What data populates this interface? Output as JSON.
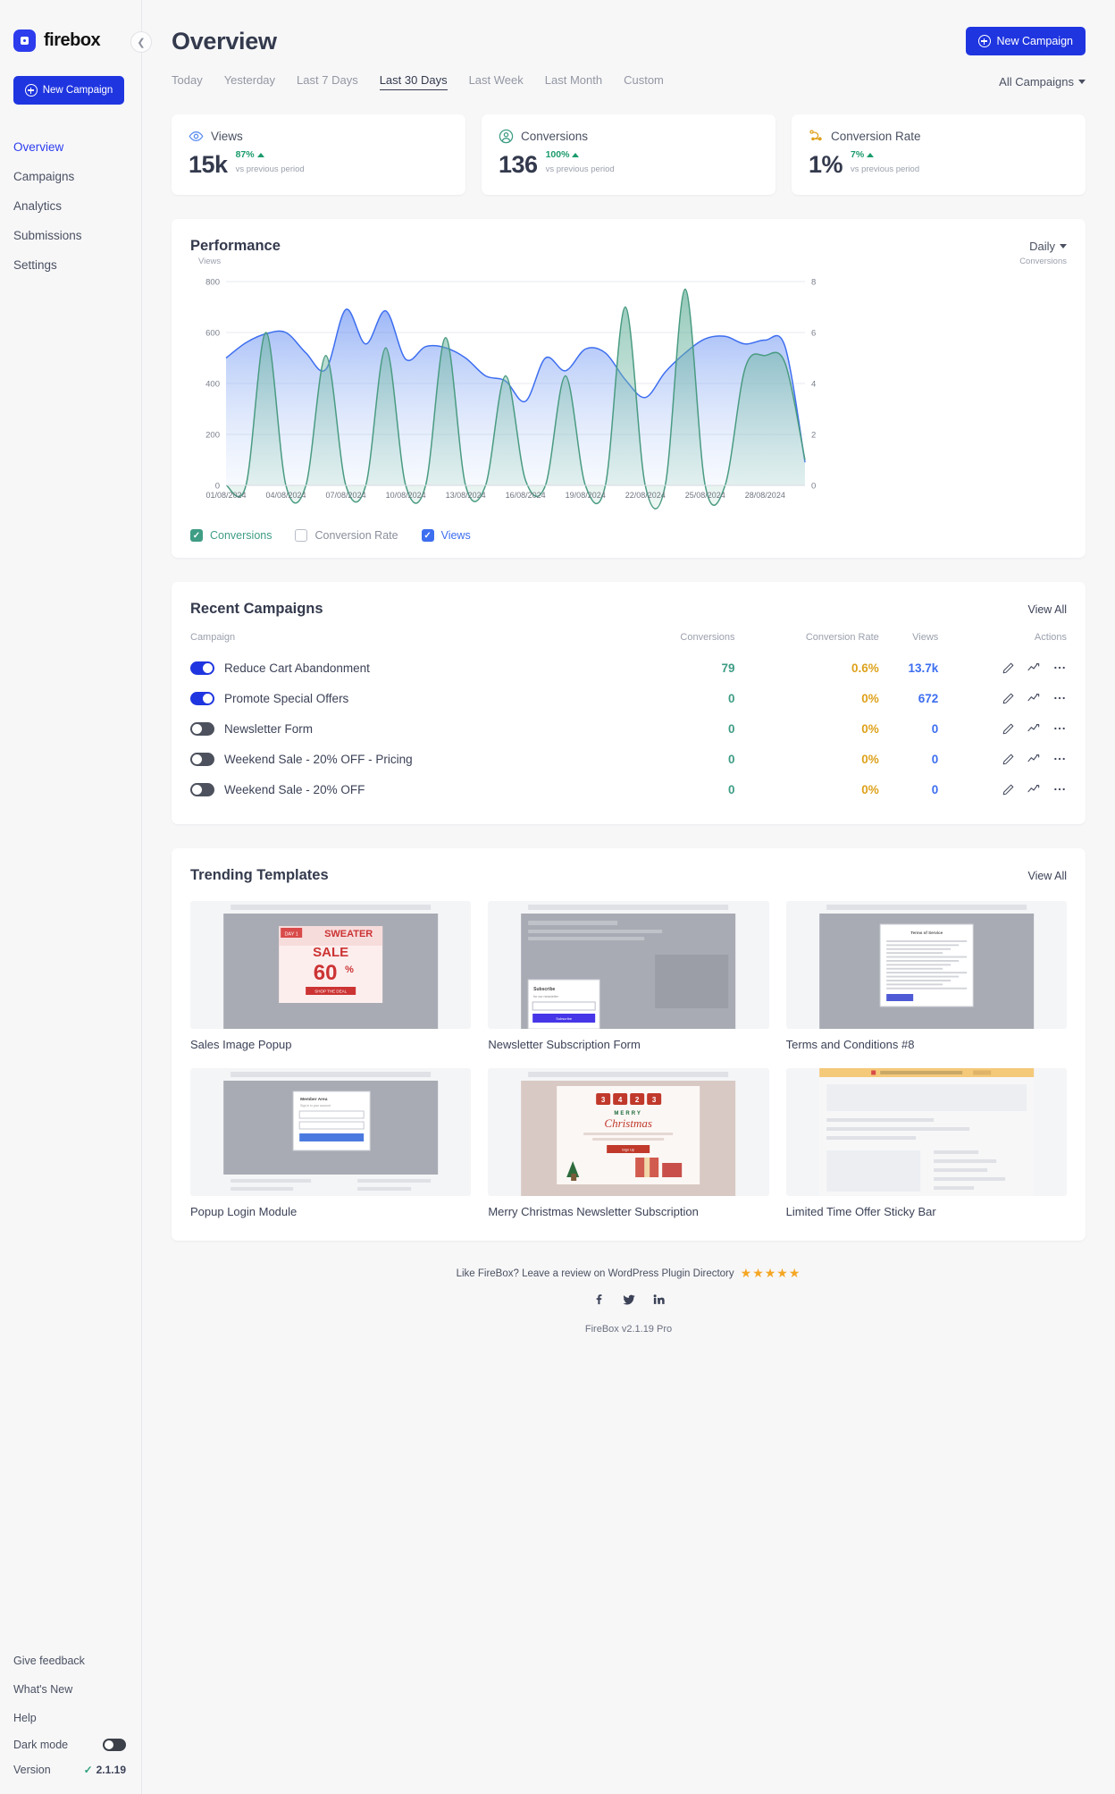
{
  "sidebar": {
    "brand": "firebox",
    "collapse_icon": "chevron-left-icon",
    "new_campaign_label": "New Campaign",
    "items": [
      {
        "label": "Overview",
        "active": true
      },
      {
        "label": "Campaigns",
        "active": false
      },
      {
        "label": "Analytics",
        "active": false
      },
      {
        "label": "Submissions",
        "active": false
      },
      {
        "label": "Settings",
        "active": false
      }
    ],
    "bottom": {
      "feedback": "Give feedback",
      "whats_new": "What's New",
      "help": "Help",
      "dark_mode_label": "Dark mode",
      "version_label": "Version",
      "version_value": "2.1.19"
    }
  },
  "header": {
    "title": "Overview",
    "new_campaign_label": "New Campaign"
  },
  "filters": {
    "date_tabs": [
      {
        "label": "Today",
        "active": false
      },
      {
        "label": "Yesterday",
        "active": false
      },
      {
        "label": "Last 7 Days",
        "active": false
      },
      {
        "label": "Last 30 Days",
        "active": true
      },
      {
        "label": "Last Week",
        "active": false
      },
      {
        "label": "Last Month",
        "active": false
      },
      {
        "label": "Custom",
        "active": false
      }
    ],
    "campaign_select": "All Campaigns"
  },
  "stats": [
    {
      "icon": "eye-icon",
      "label": "Views",
      "value": "15k",
      "delta": "87%",
      "trend": "up",
      "sub": "vs previous period",
      "color": "#5b8def"
    },
    {
      "icon": "user-circle-icon",
      "label": "Conversions",
      "value": "136",
      "delta": "100%",
      "trend": "up",
      "sub": "vs previous period",
      "color": "#3f9d85"
    },
    {
      "icon": "conversion-path-icon",
      "label": "Conversion Rate",
      "value": "1%",
      "delta": "7%",
      "trend": "up",
      "sub": "vs previous period",
      "color": "#dea21c"
    }
  ],
  "performance": {
    "title": "Performance",
    "granularity": "Daily",
    "legend": [
      {
        "label": "Conversions",
        "checked": true,
        "color": "#3f9d85"
      },
      {
        "label": "Conversion Rate",
        "checked": false,
        "color": "#b9bdc8"
      },
      {
        "label": "Views",
        "checked": true,
        "color": "#3d6ef0"
      }
    ]
  },
  "chart_data": {
    "type": "area",
    "title": "Performance",
    "ylabel": "Views",
    "y2label": "Conversions",
    "xlabel": "",
    "ylim": [
      0,
      800
    ],
    "y2lim": [
      0,
      8
    ],
    "yticks": [
      0,
      200,
      400,
      600,
      800
    ],
    "y2ticks": [
      0,
      2,
      4,
      6,
      8
    ],
    "grid": true,
    "legend_position": "bottom",
    "x": [
      "01/08/2024",
      "02/08/2024",
      "03/08/2024",
      "04/08/2024",
      "05/08/2024",
      "06/08/2024",
      "07/08/2024",
      "08/08/2024",
      "09/08/2024",
      "10/08/2024",
      "11/08/2024",
      "12/08/2024",
      "13/08/2024",
      "14/08/2024",
      "15/08/2024",
      "16/08/2024",
      "17/08/2024",
      "18/08/2024",
      "19/08/2024",
      "20/08/2024",
      "21/08/2024",
      "22/08/2024",
      "23/08/2024",
      "24/08/2024",
      "25/08/2024",
      "26/08/2024",
      "27/08/2024",
      "28/08/2024",
      "29/08/2024",
      "30/08/2024"
    ],
    "xticklabels": [
      "01/08/2024",
      "04/08/2024",
      "07/08/2024",
      "10/08/2024",
      "13/08/2024",
      "16/08/2024",
      "19/08/2024",
      "22/08/2024",
      "25/08/2024",
      "28/08/2024"
    ],
    "series": [
      {
        "name": "Views",
        "axis": "left",
        "color": "#3d6ef0",
        "values": [
          500,
          560,
          595,
          600,
          520,
          455,
          690,
          555,
          685,
          495,
          545,
          540,
          500,
          430,
          410,
          330,
          500,
          450,
          535,
          520,
          415,
          345,
          445,
          520,
          575,
          585,
          555,
          570,
          545,
          90
        ]
      },
      {
        "name": "Conversions",
        "axis": "right",
        "color": "#3f9d85",
        "values": [
          0,
          0,
          6.0,
          0,
          0,
          5.1,
          0,
          0,
          5.4,
          0,
          0,
          5.8,
          0,
          0,
          4.3,
          0.2,
          0,
          4.3,
          0,
          0,
          7.0,
          0,
          0,
          7.7,
          0,
          0,
          4.6,
          5.1,
          4.8,
          1.0
        ]
      }
    ]
  },
  "recent_campaigns": {
    "title": "Recent Campaigns",
    "view_all": "View All",
    "columns": [
      "Campaign",
      "Conversions",
      "Conversion Rate",
      "Views",
      "Actions"
    ],
    "rows": [
      {
        "enabled": true,
        "name": "Reduce Cart Abandonment",
        "conversions": "79",
        "rate": "0.6%",
        "views": "13.7k"
      },
      {
        "enabled": true,
        "name": "Promote Special Offers",
        "conversions": "0",
        "rate": "0%",
        "views": "672"
      },
      {
        "enabled": false,
        "name": "Newsletter Form",
        "conversions": "0",
        "rate": "0%",
        "views": "0"
      },
      {
        "enabled": false,
        "name": "Weekend Sale - 20% OFF - Pricing",
        "conversions": "0",
        "rate": "0%",
        "views": "0"
      },
      {
        "enabled": false,
        "name": "Weekend Sale - 20% OFF",
        "conversions": "0",
        "rate": "0%",
        "views": "0"
      }
    ],
    "action_icons": [
      "pencil-icon",
      "chart-line-icon",
      "ellipsis-icon"
    ]
  },
  "trending_templates": {
    "title": "Trending Templates",
    "view_all": "View All",
    "items": [
      {
        "label": "Sales Image Popup",
        "kind": "sale-image"
      },
      {
        "label": "Newsletter Subscription Form",
        "kind": "newsletter"
      },
      {
        "label": "Terms and Conditions #8",
        "kind": "terms"
      },
      {
        "label": "Popup Login Module",
        "kind": "login"
      },
      {
        "label": "Merry Christmas Newsletter Subscription",
        "kind": "christmas"
      },
      {
        "label": "Limited Time Offer Sticky Bar",
        "kind": "sticky-bar"
      }
    ],
    "sale_badge_day": "DAY 1",
    "sale_title": "SWEATER",
    "sale_word": "SALE",
    "sale_pct": "60",
    "sale_pct_sym": "%",
    "sale_cta": "SHOP THE DEAL",
    "newsletter_title": "Subscribe",
    "newsletter_sub": "for our newsletter",
    "newsletter_cta": "Subscribe",
    "christmas_timer": "34:23",
    "christmas_title": "Christmas",
    "christmas_pre": "MERRY",
    "christmas_cta": "Sign Up"
  },
  "footer": {
    "review_text": "Like FireBox? Leave a review on WordPress Plugin Directory",
    "stars": "★★★★★",
    "socials": [
      "facebook-icon",
      "twitter-icon",
      "linkedin-icon"
    ],
    "version": "FireBox v2.1.19 Pro"
  }
}
